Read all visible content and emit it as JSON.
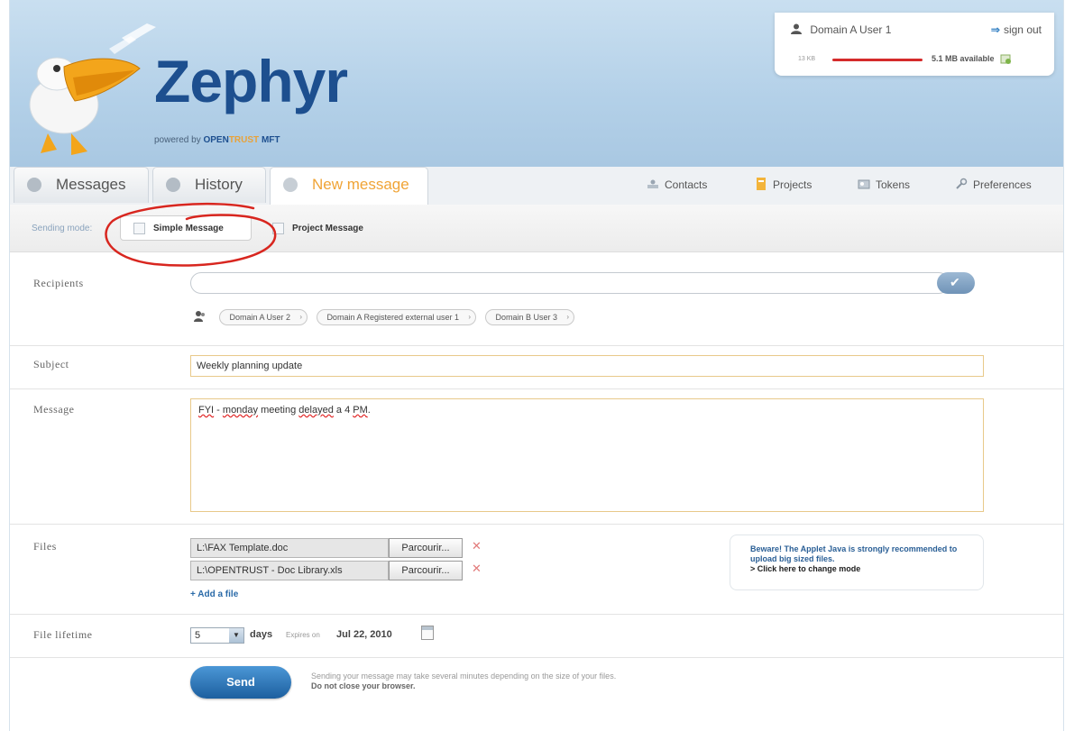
{
  "app": {
    "title": "Zephyr",
    "powered_prefix": "powered by",
    "powered_open": "OPEN",
    "powered_trust": "TRUST",
    "powered_mft": "MFT"
  },
  "user": {
    "name": "Domain A User 1",
    "signout_label": "sign out",
    "quota_used_label": "13 KB",
    "quota_available_label": "5.1 MB available"
  },
  "tabs": [
    {
      "label": "Messages"
    },
    {
      "label": "History"
    },
    {
      "label": "New message",
      "active": true
    }
  ],
  "toplinks": [
    {
      "label": "Contacts"
    },
    {
      "label": "Projects"
    },
    {
      "label": "Tokens"
    },
    {
      "label": "Preferences"
    }
  ],
  "sending_mode": {
    "label": "Sending mode:",
    "simple": "Simple Message",
    "project": "Project Message"
  },
  "form": {
    "recipients_label": "Recipients",
    "recipients_value": "",
    "recipient_chips": [
      "Domain A User 2",
      "Domain A Registered external user 1",
      "Domain B User 3"
    ],
    "subject_label": "Subject",
    "subject_value": "Weekly planning update",
    "message_label": "Message",
    "message_word1": "FYI",
    "message_sep": " - ",
    "message_word2": "monday",
    "message_mid": " meeting ",
    "message_word3": "delayed",
    "message_mid2": " a 4 ",
    "message_word4": "PM",
    "message_end": ".",
    "files_label": "Files",
    "files": [
      {
        "path": "L:\\FAX Template.doc",
        "browse": "Parcourir..."
      },
      {
        "path": "L:\\OPENTRUST - Doc Library.xls",
        "browse": "Parcourir..."
      }
    ],
    "add_file": "+ Add a file",
    "beware_strong": "Beware! The Applet Java is strongly recommended to upload big sized files.",
    "beware_link": "> Click here to change mode",
    "lifetime_label": "File lifetime",
    "lifetime_value": "5",
    "days_label": "days",
    "expires_label": "Expires on",
    "expires_value": "Jul 22, 2010",
    "send_label": "Send",
    "send_note1": "Sending your message may take several minutes depending on the size of your files.",
    "send_note2": "Do not close your browser."
  },
  "colors": {
    "header_bg": "#b3d0e8",
    "brand": "#1d4f8f",
    "active_tab": "#f0a436",
    "quota_bar": "#d52b2b",
    "annotation": "#d8261f"
  }
}
